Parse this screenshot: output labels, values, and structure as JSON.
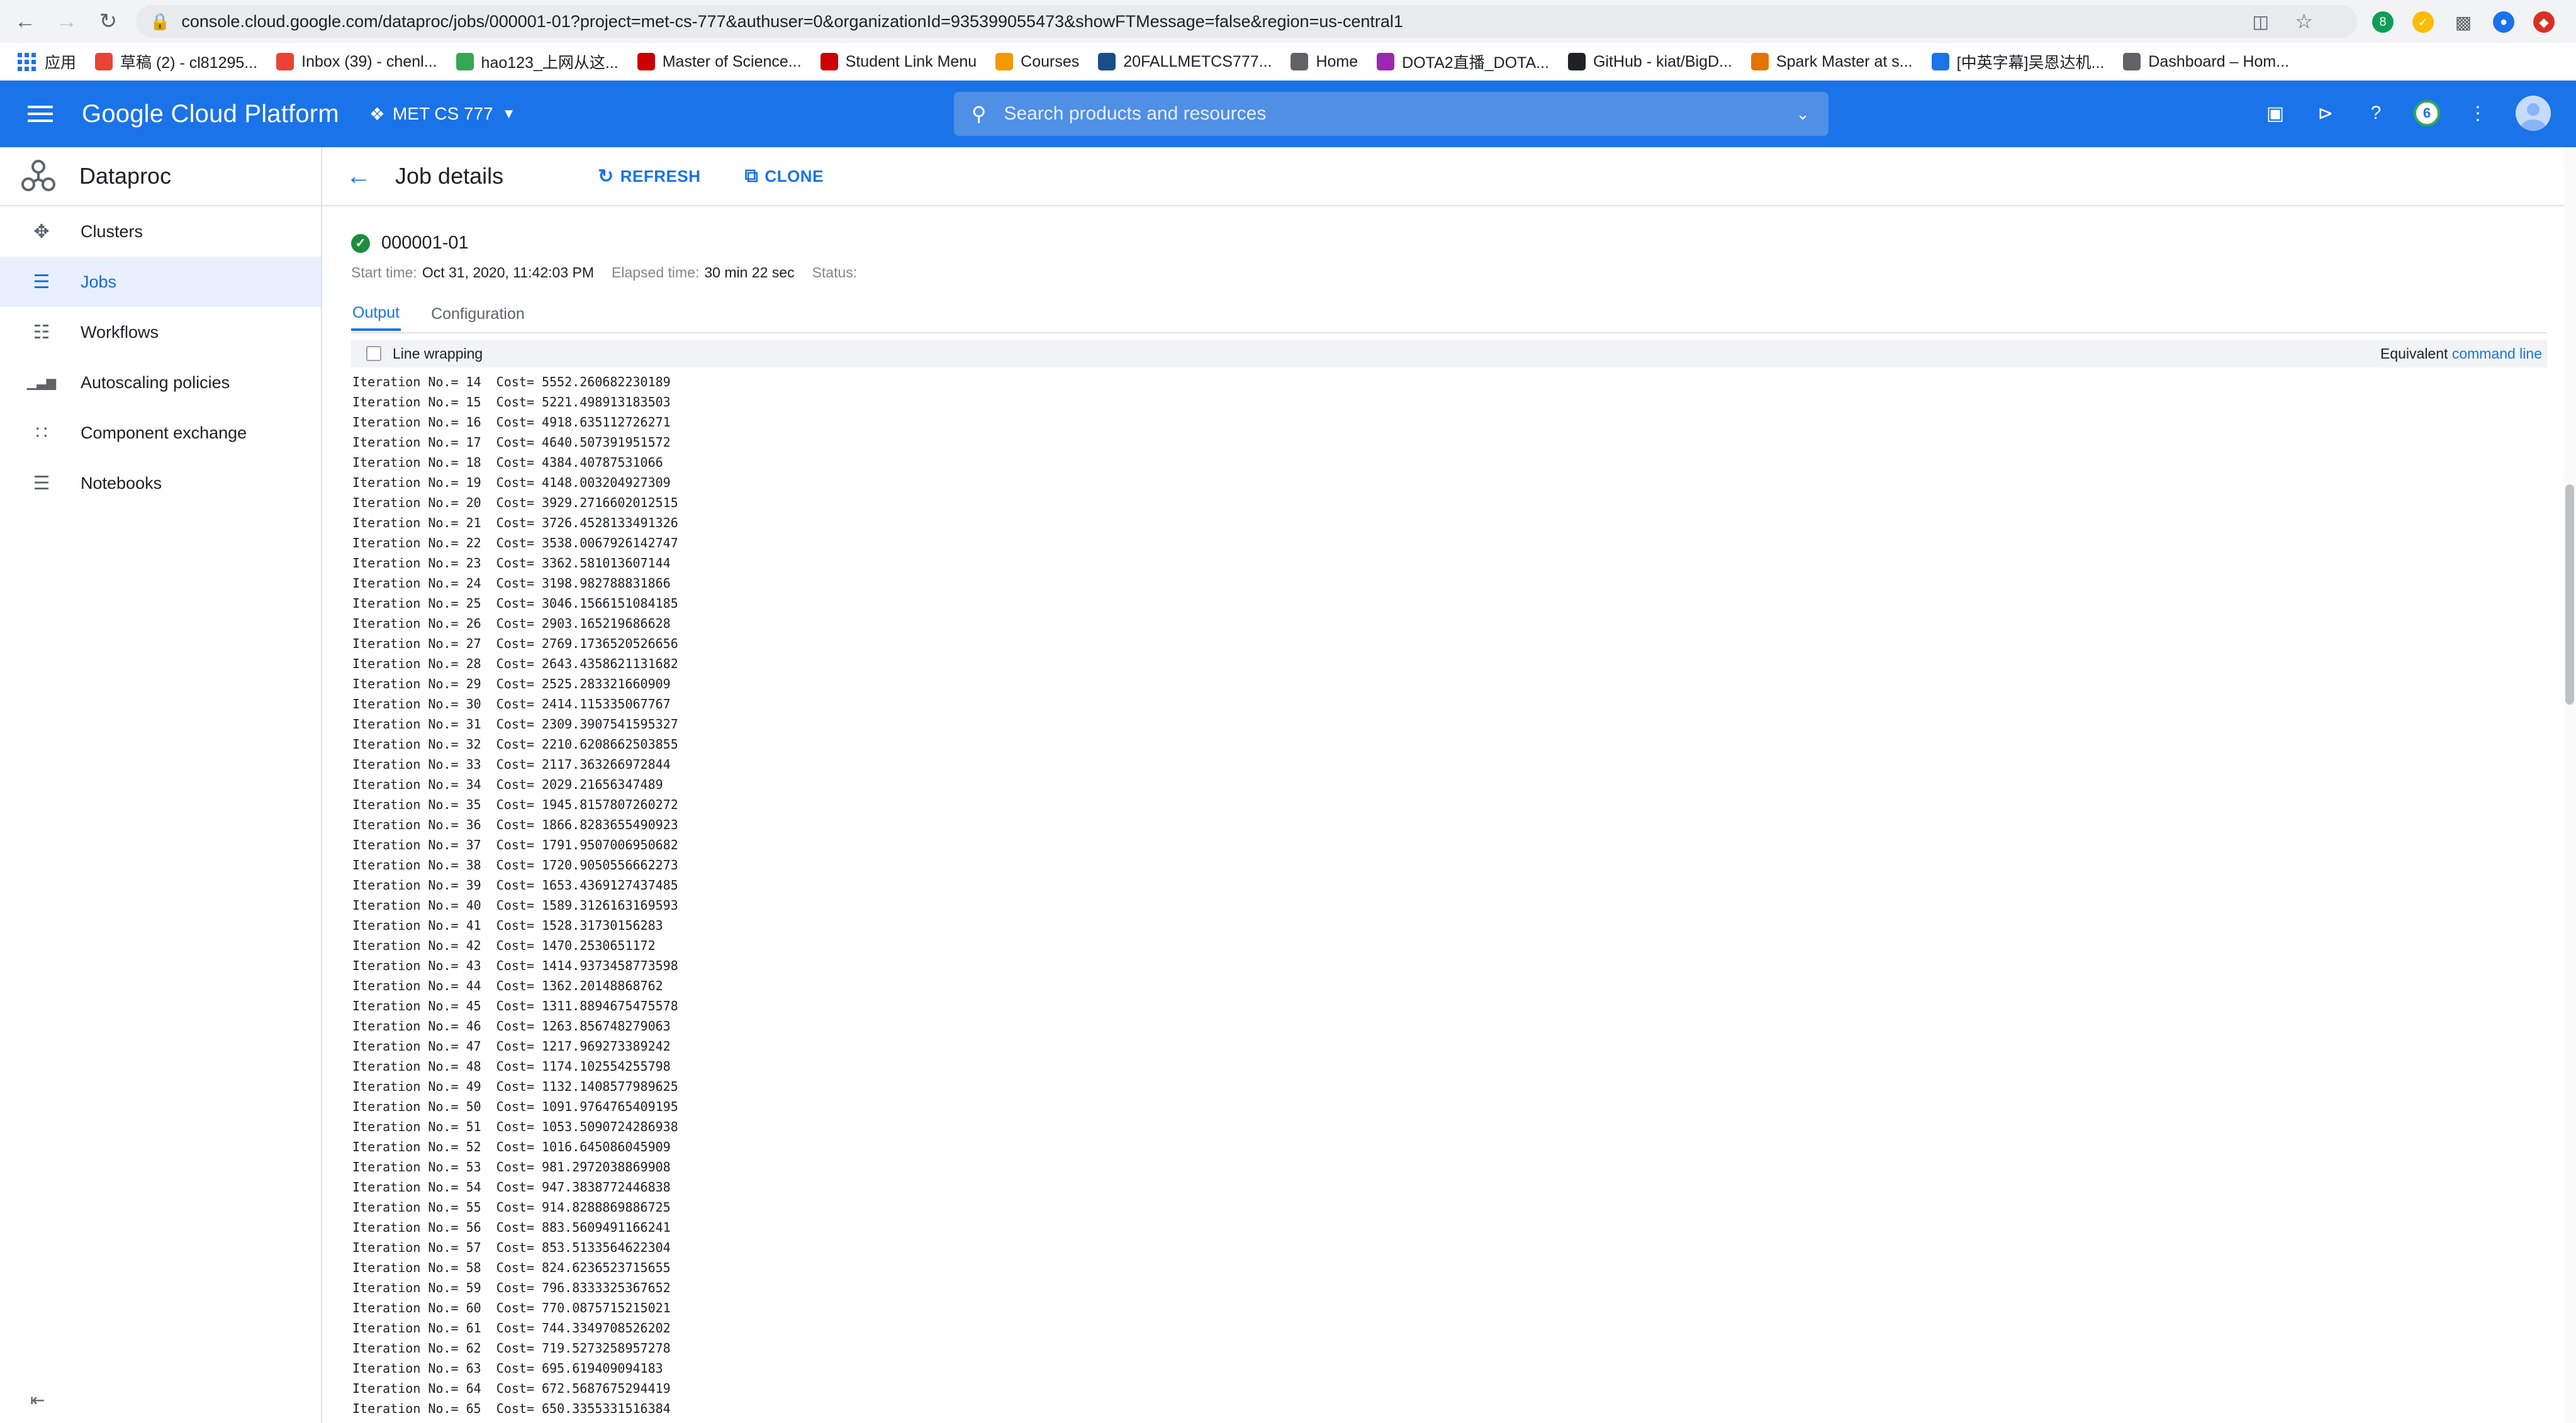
{
  "browser": {
    "url": "console.cloud.google.com/dataproc/jobs/000001-01?project=met-cs-777&authuser=0&organizationId=935399055473&showFTMessage=false&region=us-central1",
    "bookmarks": [
      {
        "label": "应用",
        "color": "#1a73e8"
      },
      {
        "label": "草稿 (2) - cl81295...",
        "color": "#ea4335"
      },
      {
        "label": "Inbox (39) - chenl...",
        "color": "#ea4335"
      },
      {
        "label": "hao123_上网从这...",
        "color": "#34a853"
      },
      {
        "label": "Master of Science...",
        "color": "#cc0000"
      },
      {
        "label": "Student Link Menu",
        "color": "#cc0000"
      },
      {
        "label": "Courses",
        "color": "#f29900"
      },
      {
        "label": "20FALLMETCS777...",
        "color": "#1a4e8a"
      },
      {
        "label": "Home",
        "color": "#5f6368"
      },
      {
        "label": "DOTA2直播_DOTA...",
        "color": "#9c27b0"
      },
      {
        "label": "GitHub - kiat/BigD...",
        "color": "#202124"
      },
      {
        "label": "Spark Master at s...",
        "color": "#e37400"
      },
      {
        "label": "[中英字幕]吴恩达机...",
        "color": "#1a73e8"
      },
      {
        "label": "Dashboard – Hom...",
        "color": "#5f6368"
      }
    ]
  },
  "header": {
    "title": "Google Cloud Platform",
    "project": "MET CS 777",
    "search_placeholder": "Search products and resources",
    "notification_count": "6"
  },
  "sidebar": {
    "product": "Dataproc",
    "items": [
      {
        "label": "Clusters",
        "icon": "clusters-icon",
        "active": false
      },
      {
        "label": "Jobs",
        "icon": "jobs-list-icon",
        "active": true
      },
      {
        "label": "Workflows",
        "icon": "workflows-icon",
        "active": false
      },
      {
        "label": "Autoscaling policies",
        "icon": "bar-chart-icon",
        "active": false
      },
      {
        "label": "Component exchange",
        "icon": "grid-icon",
        "active": false
      },
      {
        "label": "Notebooks",
        "icon": "document-icon",
        "active": false
      }
    ]
  },
  "toolbar": {
    "page_title": "Job details",
    "refresh_label": "REFRESH",
    "clone_label": "CLONE"
  },
  "job": {
    "id": "000001-01",
    "start_label": "Start time:",
    "start_value": "Oct 31, 2020, 11:42:03 PM",
    "elapsed_label": "Elapsed time:",
    "elapsed_value": "30 min 22 sec",
    "status_label": "Status:"
  },
  "tabs": [
    {
      "label": "Output",
      "active": true
    },
    {
      "label": "Configuration",
      "active": false
    }
  ],
  "output": {
    "line_wrapping_label": "Line wrapping",
    "equivalent_label": "Equivalent",
    "command_line_label": "command line",
    "lines": [
      "Iteration No.= 14  Cost= 5552.260682230189",
      "Iteration No.= 15  Cost= 5221.498913183503",
      "Iteration No.= 16  Cost= 4918.635112726271",
      "Iteration No.= 17  Cost= 4640.507391951572",
      "Iteration No.= 18  Cost= 4384.40787531066",
      "Iteration No.= 19  Cost= 4148.003204927309",
      "Iteration No.= 20  Cost= 3929.2716602012515",
      "Iteration No.= 21  Cost= 3726.4528133491326",
      "Iteration No.= 22  Cost= 3538.0067926142747",
      "Iteration No.= 23  Cost= 3362.581013607144",
      "Iteration No.= 24  Cost= 3198.982788831866",
      "Iteration No.= 25  Cost= 3046.1566151084185",
      "Iteration No.= 26  Cost= 2903.165219686628",
      "Iteration No.= 27  Cost= 2769.1736520526656",
      "Iteration No.= 28  Cost= 2643.4358621131682",
      "Iteration No.= 29  Cost= 2525.283321660909",
      "Iteration No.= 30  Cost= 2414.115335067767",
      "Iteration No.= 31  Cost= 2309.3907541595327",
      "Iteration No.= 32  Cost= 2210.6208662503855",
      "Iteration No.= 33  Cost= 2117.363266972844",
      "Iteration No.= 34  Cost= 2029.21656347489",
      "Iteration No.= 35  Cost= 1945.8157807260272",
      "Iteration No.= 36  Cost= 1866.8283655490923",
      "Iteration No.= 37  Cost= 1791.9507006950682",
      "Iteration No.= 38  Cost= 1720.9050556662273",
      "Iteration No.= 39  Cost= 1653.4369127437485",
      "Iteration No.= 40  Cost= 1589.3126163169593",
      "Iteration No.= 41  Cost= 1528.31730156283",
      "Iteration No.= 42  Cost= 1470.2530651172",
      "Iteration No.= 43  Cost= 1414.9373458773598",
      "Iteration No.= 44  Cost= 1362.20148868762",
      "Iteration No.= 45  Cost= 1311.8894675475578",
      "Iteration No.= 46  Cost= 1263.856748279063",
      "Iteration No.= 47  Cost= 1217.969273389242",
      "Iteration No.= 48  Cost= 1174.102554255798",
      "Iteration No.= 49  Cost= 1132.1408577989625",
      "Iteration No.= 50  Cost= 1091.9764765409195",
      "Iteration No.= 51  Cost= 1053.5090724286938",
      "Iteration No.= 52  Cost= 1016.645086045909",
      "Iteration No.= 53  Cost= 981.2972038869908",
      "Iteration No.= 54  Cost= 947.3838772446838",
      "Iteration No.= 55  Cost= 914.8288869886725",
      "Iteration No.= 56  Cost= 883.5609491166241",
      "Iteration No.= 57  Cost= 853.5133564622304",
      "Iteration No.= 58  Cost= 824.6236523715655",
      "Iteration No.= 59  Cost= 796.8333325367652",
      "Iteration No.= 60  Cost= 770.0875715215021",
      "Iteration No.= 61  Cost= 744.3349708526202",
      "Iteration No.= 62  Cost= 719.5273258957278",
      "Iteration No.= 63  Cost= 695.619409094183",
      "Iteration No.= 64  Cost= 672.5687675294419",
      "Iteration No.= 65  Cost= 650.3355331516384"
    ]
  }
}
